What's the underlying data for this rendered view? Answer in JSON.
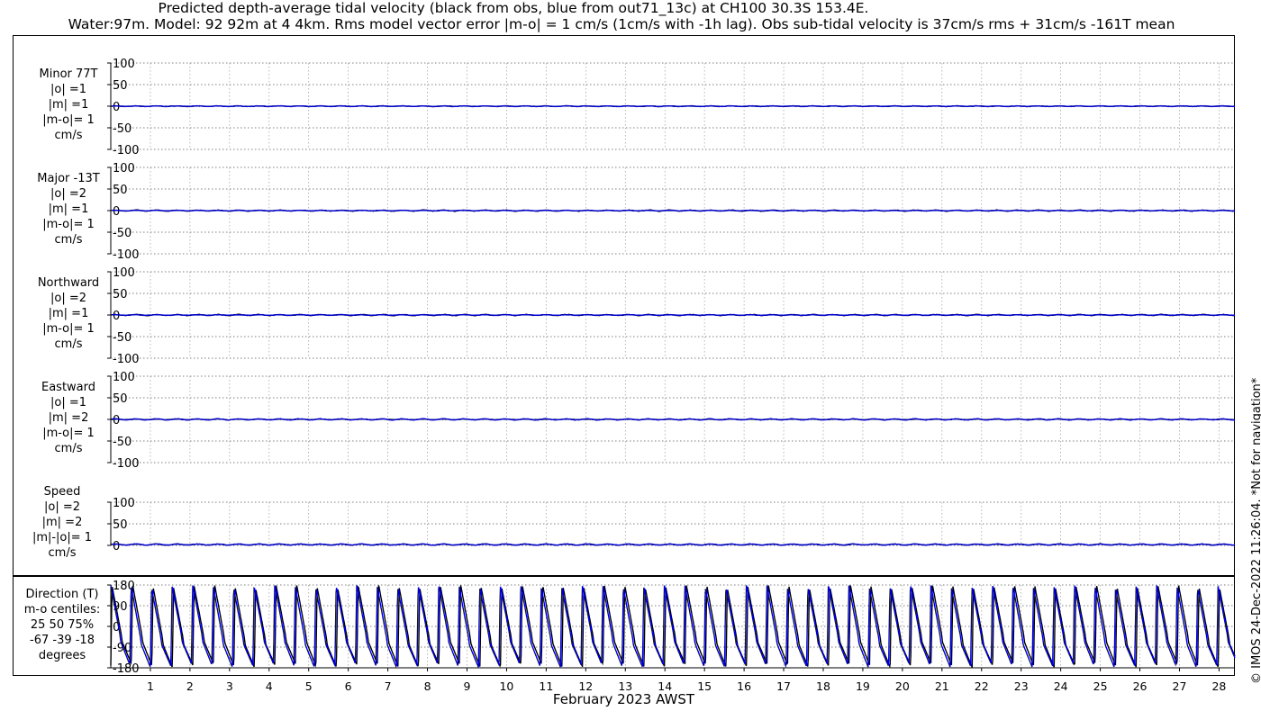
{
  "title_line1": "Predicted depth-average tidal velocity (black from obs, blue from out71_13c) at CH100 30.3S 153.4E.",
  "title_line2": "Water:97m. Model: 92 92m at 4 4km. Rms model vector error |m-o| = 1 cm/s (1cm/s with -1h lag). Obs sub-tidal velocity is 37cm/s rms + 31cm/s -161T mean",
  "side_note": "© IMOS 24-Dec-2022 11:26:04. *Not for navigation*",
  "colors": {
    "obs": "#000000",
    "model": "#0000cc",
    "grid": "#9a9a9a"
  },
  "chart_data": {
    "type": "line",
    "xlabel": "February 2023 AWST",
    "x_ticks": [
      "1",
      "2",
      "3",
      "4",
      "5",
      "6",
      "7",
      "8",
      "9",
      "10",
      "11",
      "12",
      "13",
      "14",
      "15",
      "16",
      "17",
      "18",
      "19",
      "20",
      "21",
      "22",
      "23",
      "24",
      "25",
      "26",
      "27",
      "28"
    ],
    "xlim": [
      0,
      28.4
    ],
    "series_legend": {
      "black": "obs",
      "blue": "out71_13c"
    },
    "panels": [
      {
        "id": "minor",
        "label": [
          "Minor 77T",
          "|o| =1",
          "|m| =1",
          "|m-o|= 1",
          "cm/s"
        ],
        "ylim": [
          -100,
          100
        ],
        "yticks": [
          "100",
          "50",
          "0",
          "-50",
          "-100"
        ],
        "tick_values": [
          100,
          50,
          0,
          -50,
          -100
        ],
        "obs_amplitude": 1,
        "model_amplitude": 1,
        "offset": 0
      },
      {
        "id": "major",
        "label": [
          "Major -13T",
          "|o| =2",
          "|m| =1",
          "|m-o|= 1",
          "cm/s"
        ],
        "ylim": [
          -100,
          100
        ],
        "yticks": [
          "100",
          "50",
          "0",
          "-50",
          "-100"
        ],
        "tick_values": [
          100,
          50,
          0,
          -50,
          -100
        ],
        "obs_amplitude": 2,
        "model_amplitude": 1,
        "offset": 0
      },
      {
        "id": "northward",
        "label": [
          "Northward",
          "|o| =2",
          "|m| =1",
          "|m-o|= 1",
          "cm/s"
        ],
        "ylim": [
          -100,
          100
        ],
        "yticks": [
          "100",
          "50",
          "0",
          "-50",
          "-100"
        ],
        "tick_values": [
          100,
          50,
          0,
          -50,
          -100
        ],
        "obs_amplitude": 2,
        "model_amplitude": 1,
        "offset": 0
      },
      {
        "id": "eastward",
        "label": [
          "Eastward",
          "|o| =1",
          "|m| =2",
          "|m-o|= 1",
          "cm/s"
        ],
        "ylim": [
          -100,
          100
        ],
        "yticks": [
          "100",
          "50",
          "0",
          "-50",
          "-100"
        ],
        "tick_values": [
          100,
          50,
          0,
          -50,
          -100
        ],
        "obs_amplitude": 1,
        "model_amplitude": 2,
        "offset": 0
      },
      {
        "id": "speed",
        "label": [
          "Speed",
          "|o| =2",
          "|m| =2",
          "|m|-|o|= 1",
          "cm/s"
        ],
        "ylim": [
          0,
          100
        ],
        "yticks": [
          "100",
          "50",
          "0"
        ],
        "tick_values": [
          100,
          50,
          0
        ],
        "obs_amplitude": 2,
        "model_amplitude": 2,
        "offset": 2
      }
    ],
    "direction_panel": {
      "label": [
        "Direction (T)",
        "m-o centiles:",
        "25  50  75%",
        "-67 -39 -18",
        "degrees"
      ],
      "ylim": [
        -180,
        180
      ],
      "yticks": [
        "180",
        "90",
        "0",
        "-90",
        "-180"
      ],
      "tick_values": [
        180,
        90,
        0,
        -90,
        -180
      ],
      "cycles_per_day": 1.93
    }
  }
}
